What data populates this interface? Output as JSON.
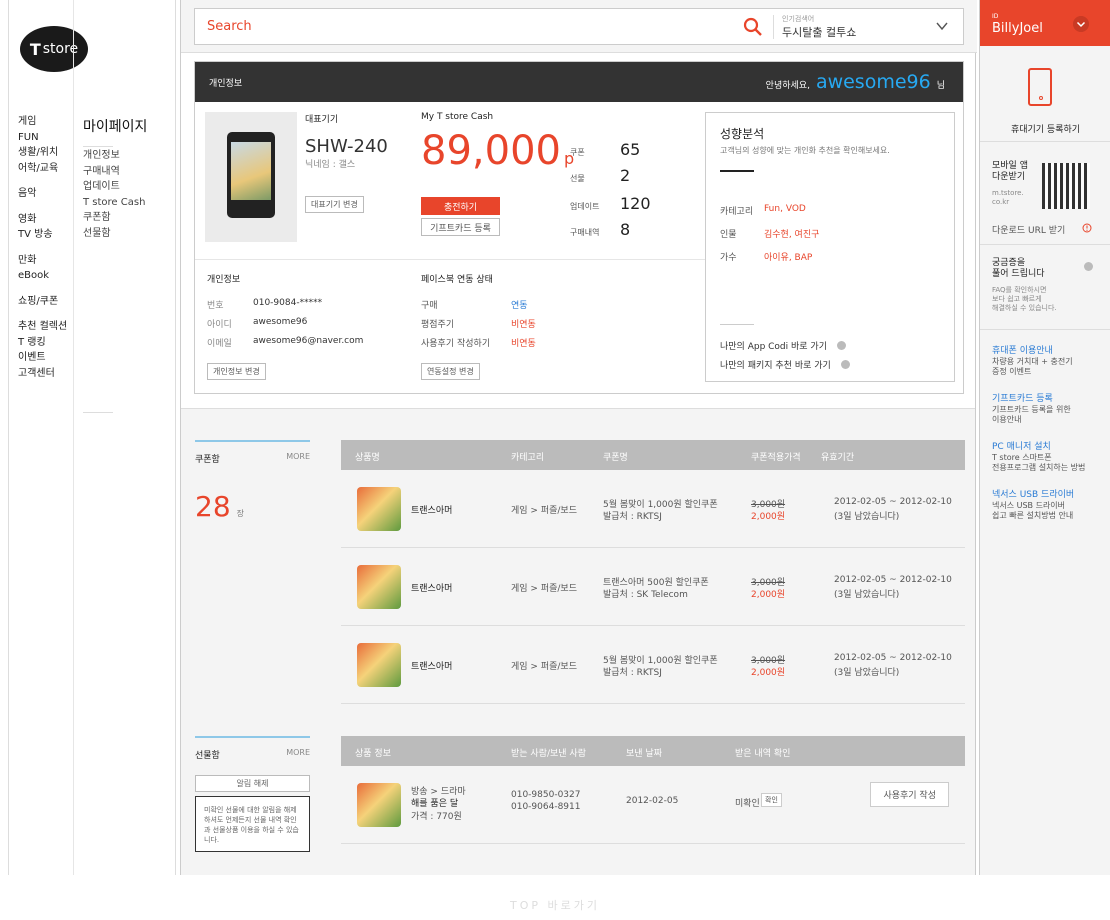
{
  "app": {
    "logo_text": "store",
    "logo_mark": "T"
  },
  "left_nav": {
    "groups": [
      [
        "게임",
        "FUN",
        "생활/위치",
        "어학/교육"
      ],
      [
        "음악"
      ],
      [
        "영화",
        "TV 방송"
      ],
      [
        "만화",
        "eBook"
      ],
      [
        "쇼핑/쿠폰"
      ],
      [
        "추천 컬렉션",
        "T 랭킹",
        "이벤트",
        "고객센터"
      ]
    ]
  },
  "mypage": {
    "title": "마이페이지",
    "items": [
      "개인정보",
      "구매내역",
      "업데이트",
      "T store Cash",
      "쿠폰함",
      "선물함"
    ]
  },
  "search": {
    "placeholder": "Search",
    "popular_label": "인기검색어",
    "popular_value": "두시탈출 컬투쇼"
  },
  "profile": {
    "header_title": "개인정보",
    "greeting": "안녕하세요,",
    "username": "awesome96",
    "honorific": "님",
    "rep_device_label": "대표기기",
    "rep_device_model": "SHW-240",
    "rep_device_nick": "닉네임 : 갤스",
    "rep_device_btn": "대표기기 변경",
    "cash_label": "My T store Cash",
    "cash_value": "89,000",
    "cash_unit": "p",
    "charge_btn": "충전하기",
    "giftcard_btn": "기프트카드 등록",
    "stats": [
      {
        "label": "쿠폰",
        "value": "65"
      },
      {
        "label": "선물",
        "value": "2"
      },
      {
        "label": "업데이트",
        "value": "120"
      },
      {
        "label": "구매내역",
        "value": "8"
      }
    ],
    "personal": {
      "title": "개인정보",
      "rows": [
        {
          "key": "번호",
          "value": "010-9084-*****"
        },
        {
          "key": "아이디",
          "value": "awesome96"
        },
        {
          "key": "이메일",
          "value": "awesome96@naver.com"
        }
      ],
      "btn": "개인정보 변경"
    },
    "facebook": {
      "title": "페이스북 연동 상태",
      "rows": [
        {
          "key": "구매",
          "value": "연동",
          "color": "#2a7bd4"
        },
        {
          "key": "평점주기",
          "value": "비연동",
          "color": "#e8452b"
        },
        {
          "key": "사용후기 작성하기",
          "value": "비연동",
          "color": "#e8452b"
        }
      ],
      "btn": "연동설정 변경"
    },
    "analysis": {
      "title": "성향분석",
      "subtitle": "고객님의 성향에 맞는 개인화 추천을 확인해보세요.",
      "rows": [
        {
          "key": "카테고리",
          "value": "Fun, VOD"
        },
        {
          "key": "인물",
          "value": "김수현, 여진구"
        },
        {
          "key": "가수",
          "value": "아이유, BAP"
        }
      ],
      "links": [
        "나만의 App Codi 바로 가기",
        "나만의 패키지 추천 바로 가기"
      ]
    }
  },
  "coupons": {
    "title": "쿠폰함",
    "more": "MORE",
    "count": "28",
    "count_unit": "장",
    "columns": [
      "상품명",
      "카테고리",
      "쿠폰명",
      "쿠폰적용가격",
      "유효기간"
    ],
    "rows": [
      {
        "name": "트랜스아머",
        "category": "게임 > 퍼즐/보드",
        "coupon1": "5월 봄맞이 1,000원 할인쿠폰",
        "coupon2": "발급처 : RKTSJ",
        "orig": "3,000원",
        "price": "2,000원",
        "period": "2012-02-05 ~ 2012-02-10",
        "remain": "(3일 남았습니다)"
      },
      {
        "name": "트랜스아머",
        "category": "게임 > 퍼즐/보드",
        "coupon1": "트랜스아머 500원 할인쿠폰",
        "coupon2": "발급처 : SK Telecom",
        "orig": "3,000원",
        "price": "2,000원",
        "period": "2012-02-05 ~ 2012-02-10",
        "remain": "(3일 남았습니다)"
      },
      {
        "name": "트랜스아머",
        "category": "게임 > 퍼즐/보드",
        "coupon1": "5월 봄맞이 1,000원 할인쿠폰",
        "coupon2": "발급처 : RKTSJ",
        "orig": "3,000원",
        "price": "2,000원",
        "period": "2012-02-05 ~ 2012-02-10",
        "remain": "(3일 남았습니다)"
      }
    ]
  },
  "gifts": {
    "title": "선물함",
    "more": "MORE",
    "alert_btn": "알림 해제",
    "alert_tip": "미확인 선물에 대한 알림을 해제하셔도 언제든지 선물 내역 확인과 선물상품 이용을 하실 수 있습니다.",
    "columns": [
      "상품 정보",
      "받는 사람/보낸 사람",
      "보낸 날짜",
      "받은 내역 확인"
    ],
    "rows": [
      {
        "category": "방송 > 드라마",
        "name": "해를 품은 달",
        "price": "가격 : 770원",
        "phone1": "010-9850-0327",
        "phone2": "010-9064-8911",
        "date": "2012-02-05",
        "status": "미확인",
        "confirm": "확인",
        "review_btn": "사용후기 작성"
      }
    ]
  },
  "right_bar": {
    "id_label": "ID",
    "username": "BillyJoel",
    "register_device": "휴대기기 등록하기",
    "mobile_app_title": "모바일 앱\n다운받기",
    "mobile_app_url": "m.tstore.\nco.kr",
    "download_url": "다운로드 URL 받기",
    "faq_title": "궁금증을\n풀어 드립니다",
    "faq_text": "FAQ를 확인하시면\n보다 쉽고 빠르게\n해결하실 수 있습니다.",
    "links": [
      {
        "title": "휴대폰 이용안내",
        "text": "차량용 거치대 + 충전기\n증정 이벤트"
      },
      {
        "title": "기프트카드 등록",
        "text": "기프트카드 등록을 위한\n이용안내"
      },
      {
        "title": "PC 매니저 설치",
        "text": "T store 스마트폰\n전용프로그램 설치하는 방법"
      },
      {
        "title": "넥서스 USB 드라이버",
        "text": "넥서스 USB 드라이버\n쉽고 빠른 설치방법 안내"
      }
    ]
  },
  "footer": {
    "text": "TOP 바로가기"
  },
  "colors": {
    "accent": "#e8452b",
    "link": "#2a7bd4",
    "username": "#27a9f2"
  }
}
